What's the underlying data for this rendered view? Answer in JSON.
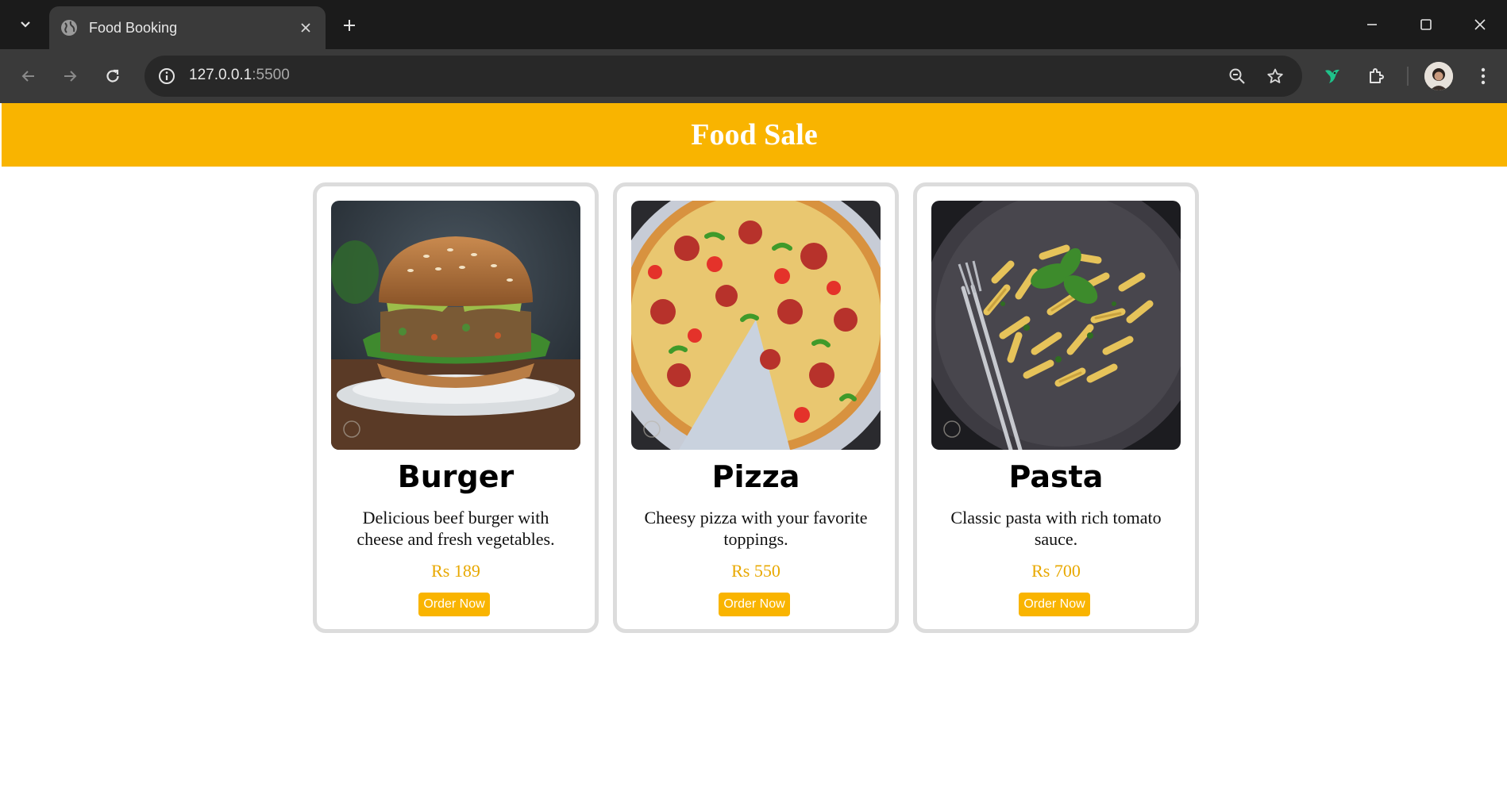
{
  "browser": {
    "tab_title": "Food Booking",
    "url_host": "127.0.0.1",
    "url_port": ":5500",
    "icons": {
      "tab_search": "chevron-down-icon",
      "favicon": "globe-icon",
      "tab_close": "close-icon",
      "new_tab": "plus-icon",
      "minimize": "minimize-icon",
      "maximize": "maximize-icon",
      "close_window": "close-icon",
      "back": "arrow-left-icon",
      "forward": "arrow-right-icon",
      "reload": "reload-icon",
      "site_info": "info-icon",
      "zoom": "zoom-out-icon",
      "bookmark": "star-icon",
      "extension_bird": "bird-extension-icon",
      "extensions": "puzzle-icon",
      "profile": "avatar",
      "menu": "kebab-menu-icon"
    }
  },
  "page": {
    "banner_title": "Food Sale",
    "accent_color": "#f9b400",
    "cards": [
      {
        "name": "Burger",
        "description": "Delicious beef burger with cheese and fresh vegetables.",
        "price": "Rs 189",
        "button_label": "Order Now"
      },
      {
        "name": "Pizza",
        "description": "Cheesy pizza with your favorite toppings.",
        "price": "Rs 550",
        "button_label": "Order Now"
      },
      {
        "name": "Pasta",
        "description": "Classic pasta with rich tomato sauce.",
        "price": "Rs 700",
        "button_label": "Order Now"
      }
    ]
  }
}
